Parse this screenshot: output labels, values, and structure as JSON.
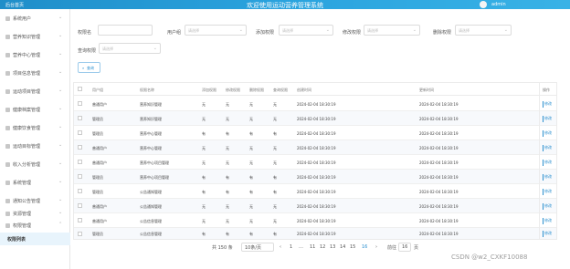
{
  "header": {
    "logo_text": "后台首页",
    "title": "欢迎使用运动营养管理系统",
    "user": "admin"
  },
  "sidebar": {
    "items": [
      {
        "label": "系统用户",
        "icon": "user-icon"
      },
      {
        "label": "营养知识管理",
        "icon": "book-icon"
      },
      {
        "label": "营养中心管理",
        "icon": "folder-icon"
      },
      {
        "label": "项目信息管理",
        "icon": "list-icon"
      },
      {
        "label": "运动项目管理",
        "icon": "list-icon"
      },
      {
        "label": "健康档案管理",
        "icon": "list-icon"
      },
      {
        "label": "健康饮食管理",
        "icon": "heart-icon"
      },
      {
        "label": "运动目标管理",
        "icon": "list-icon"
      },
      {
        "label": "收入分析管理",
        "icon": "list-icon"
      },
      {
        "label": "系统管理",
        "icon": "gear-icon"
      },
      {
        "label": "通知公告管理",
        "icon": "bell-icon"
      },
      {
        "label": "资源管理",
        "icon": "location-icon"
      },
      {
        "label": "权限管理",
        "icon": "person-icon"
      }
    ],
    "active_item": "权限列表"
  },
  "filters": {
    "account_label": "权限名",
    "role_label": "用户组",
    "add_label": "添加权限",
    "edit_label": "修改权限",
    "delete_label": "删除权限",
    "query_label": "查询权限",
    "placeholder": "请选择",
    "search_button": "查询"
  },
  "table": {
    "headers": [
      "用户组",
      "权限名称",
      "添加权限",
      "修改权限",
      "删除权限",
      "查询权限",
      "创建时间",
      "更新时间",
      "操作"
    ],
    "rows": [
      [
        "普通用户",
        "营养知识管理",
        "无",
        "无",
        "无",
        "无",
        "2024-02-04 18:30:19",
        "2024-02-04 18:30:19",
        "修改"
      ],
      [
        "管理员",
        "营养知识管理",
        "无",
        "无",
        "无",
        "无",
        "2024-02-04 18:30:19",
        "2024-02-04 18:30:19",
        "修改"
      ],
      [
        "管理员",
        "营养中心管理",
        "有",
        "有",
        "有",
        "有",
        "2024-02-04 18:30:19",
        "2024-02-04 18:30:19",
        "修改"
      ],
      [
        "普通用户",
        "营养中心管理",
        "无",
        "无",
        "无",
        "无",
        "2024-02-04 18:30:19",
        "2024-02-04 18:30:19",
        "修改"
      ],
      [
        "普通用户",
        "营养中心项目管理",
        "无",
        "无",
        "无",
        "无",
        "2024-02-04 18:30:19",
        "2024-02-04 18:30:19",
        "修改"
      ],
      [
        "管理员",
        "营养中心项目管理",
        "有",
        "有",
        "有",
        "有",
        "2024-02-04 18:30:19",
        "2024-02-04 18:30:19",
        "修改"
      ],
      [
        "管理员",
        "公告通知管理",
        "有",
        "有",
        "有",
        "有",
        "2024-02-04 18:30:19",
        "2024-02-04 18:30:19",
        "修改"
      ],
      [
        "普通用户",
        "公告通知管理",
        "无",
        "无",
        "无",
        "无",
        "2024-02-04 18:30:19",
        "2024-02-04 18:30:19",
        "修改"
      ],
      [
        "普通用户",
        "公告信息管理",
        "无",
        "无",
        "无",
        "无",
        "2024-02-04 18:30:19",
        "2024-02-04 18:30:19",
        "修改"
      ],
      [
        "管理员",
        "公告信息管理",
        "有",
        "有",
        "有",
        "有",
        "2024-02-04 18:30:19",
        "2024-02-04 18:30:19",
        "修改"
      ]
    ]
  },
  "pagination": {
    "total": "共 150 条",
    "page_size": "10条/页",
    "prev": "‹",
    "pages": [
      "1",
      "…",
      "11",
      "12",
      "13",
      "14",
      "15"
    ],
    "active_page": "16",
    "next": "›",
    "goto_label": "前往",
    "goto_value": "16",
    "goto_suffix": "页"
  },
  "watermark": "CSDN @w2_CXKF10088"
}
